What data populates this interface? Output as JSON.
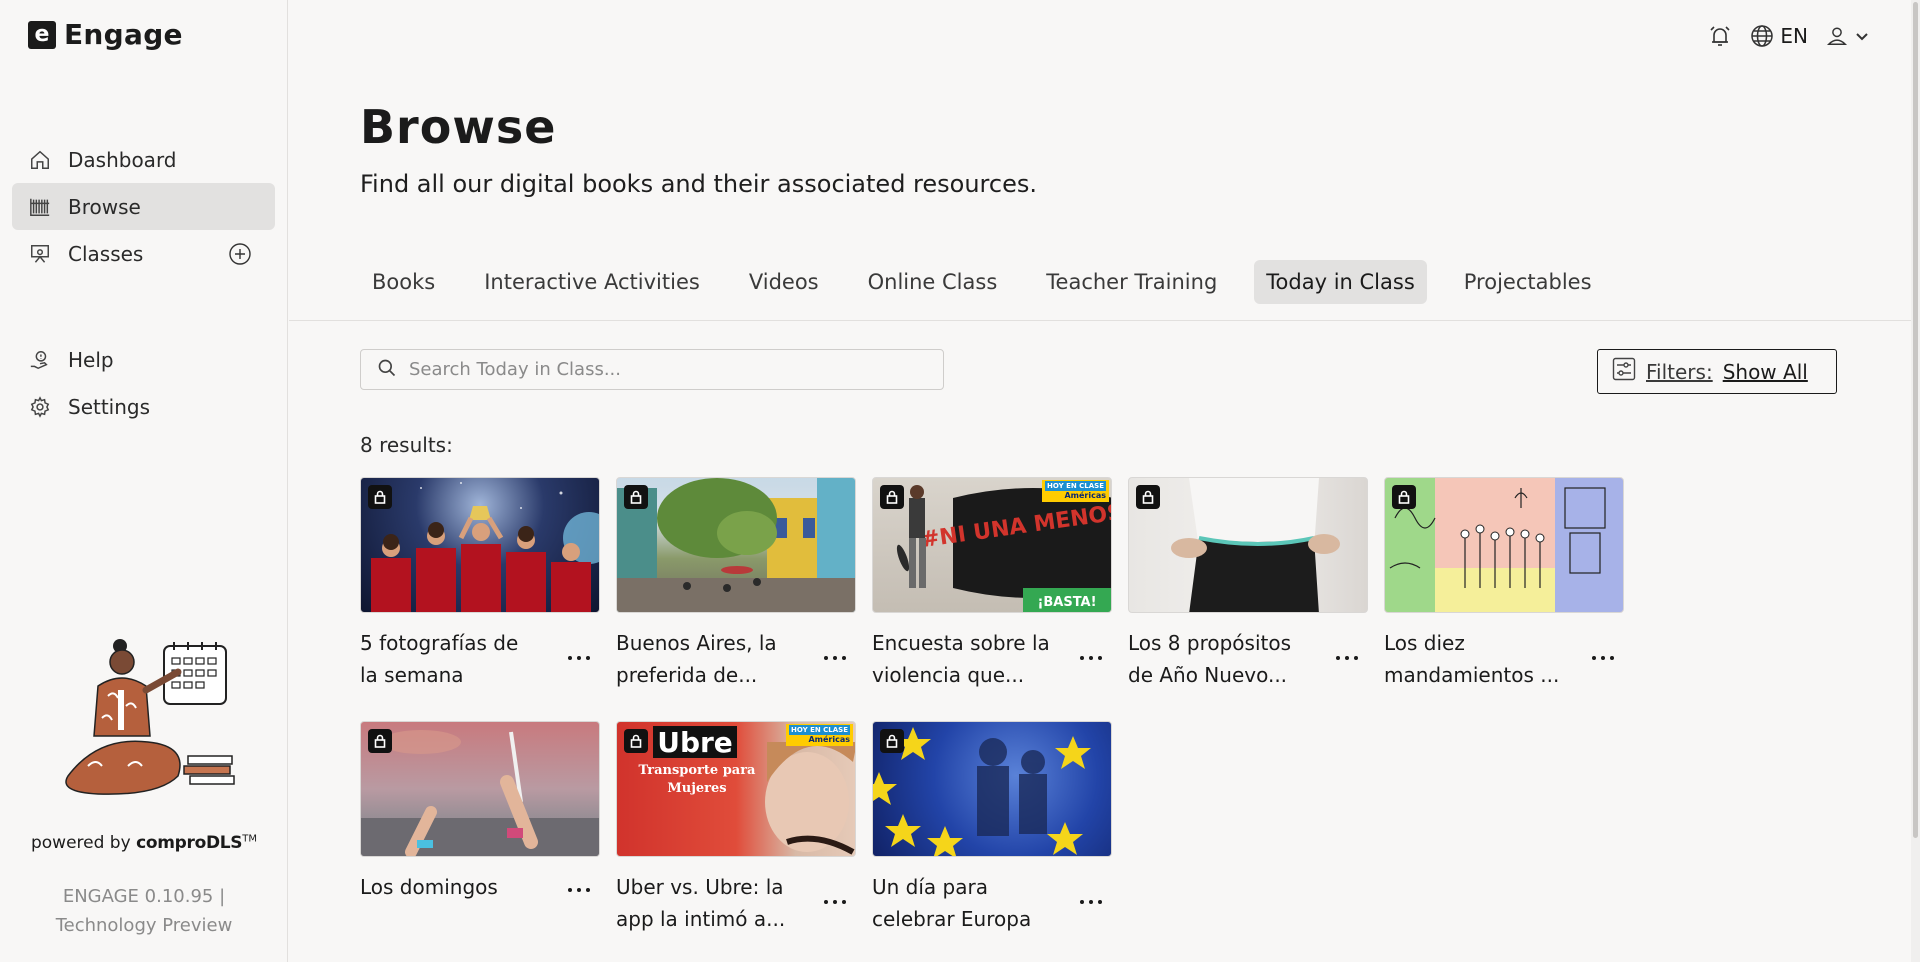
{
  "app": {
    "name": "Engage",
    "logo_letter": "e"
  },
  "sidebar": {
    "items": [
      {
        "label": "Dashboard",
        "icon": "home-icon"
      },
      {
        "label": "Browse",
        "icon": "bookshelf-icon",
        "active": true
      },
      {
        "label": "Classes",
        "icon": "classroom-icon",
        "action_icon": "plus-circle-icon"
      }
    ],
    "secondary_items": [
      {
        "label": "Help",
        "icon": "help-hand-icon"
      },
      {
        "label": "Settings",
        "icon": "gear-icon"
      }
    ],
    "powered_by_prefix": "powered by",
    "powered_by_brand": "comproDLS",
    "powered_by_tm": "TM",
    "version_line1": "ENGAGE 0.10.95 |",
    "version_line2": "Technology Preview"
  },
  "topbar": {
    "language": "EN",
    "icons": [
      "alarm-bell-icon",
      "globe-icon",
      "user-icon",
      "chevron-down-icon"
    ]
  },
  "main": {
    "title": "Browse",
    "subtitle": "Find all our digital books and their associated resources.",
    "tabs": [
      {
        "label": "Books"
      },
      {
        "label": "Interactive Activities"
      },
      {
        "label": "Videos"
      },
      {
        "label": "Online Class"
      },
      {
        "label": "Teacher Training"
      },
      {
        "label": "Today in Class",
        "active": true
      },
      {
        "label": "Projectables"
      }
    ],
    "search": {
      "placeholder": "Search Today in Class...",
      "value": ""
    },
    "filters": {
      "label": "Filters:",
      "value": "Show All"
    },
    "results_text": "8 results:",
    "cards": [
      {
        "title_line1": "5 fotografías de",
        "title_line2": "la semana",
        "thumb": "celebration-photo"
      },
      {
        "title_line1": "Buenos Aires, la",
        "title_line2": "preferida de...",
        "thumb": "street-photo"
      },
      {
        "title_line1": "Encuesta sobre la",
        "title_line2": "violencia que...",
        "thumb": "mural-photo",
        "overlay_text": "#NI UNA MENOS",
        "badge_line1": "HOY EN CLASE",
        "badge_line2": "Américas",
        "corner_text": "¡BASTA!"
      },
      {
        "title_line1": "Los 8 propósitos",
        "title_line2": "de Año Nuevo...",
        "thumb": "fitness-photo"
      },
      {
        "title_line1": "Los diez",
        "title_line2": "mandamientos ...",
        "thumb": "illustration"
      },
      {
        "title_line1": "Los domingos",
        "title_line2": "",
        "thumb": "painting-photo"
      },
      {
        "title_line1": "Uber vs. Ubre: la",
        "title_line2": "app la intimó a...",
        "thumb": "ubre-photo",
        "overlay_text": "Ubre",
        "overlay_sub1": "Transporte para",
        "overlay_sub2": "Mujeres",
        "badge_line1": "HOY EN CLASE",
        "badge_line2": "Américas"
      },
      {
        "title_line1": "Un día para",
        "title_line2": "celebrar Europa",
        "thumb": "eu-flag-photo"
      }
    ]
  }
}
